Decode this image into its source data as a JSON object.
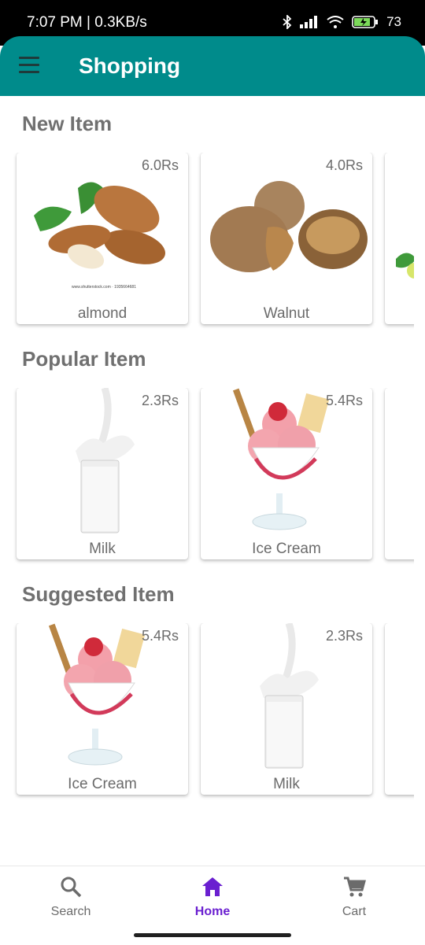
{
  "status_bar": {
    "time_speed": "7:07 PM | 0.3KB/s",
    "battery": "73"
  },
  "app_bar": {
    "title": "Shopping"
  },
  "sections": [
    {
      "title": "New Item",
      "items": [
        {
          "price": "6.0Rs",
          "name": "almond"
        },
        {
          "price": "4.0Rs",
          "name": "Walnut"
        }
      ]
    },
    {
      "title": "Popular Item",
      "items": [
        {
          "price": "2.3Rs",
          "name": "Milk"
        },
        {
          "price": "5.4Rs",
          "name": "Ice Cream"
        }
      ]
    },
    {
      "title": "Suggested Item",
      "items": [
        {
          "price": "5.4Rs",
          "name": "Ice Cream"
        },
        {
          "price": "2.3Rs",
          "name": "Milk"
        }
      ]
    }
  ],
  "bottom_nav": {
    "search": "Search",
    "home": "Home",
    "cart": "Cart"
  },
  "colors": {
    "app_bar": "#008b8b",
    "active_nav": "#6a1fd0"
  }
}
